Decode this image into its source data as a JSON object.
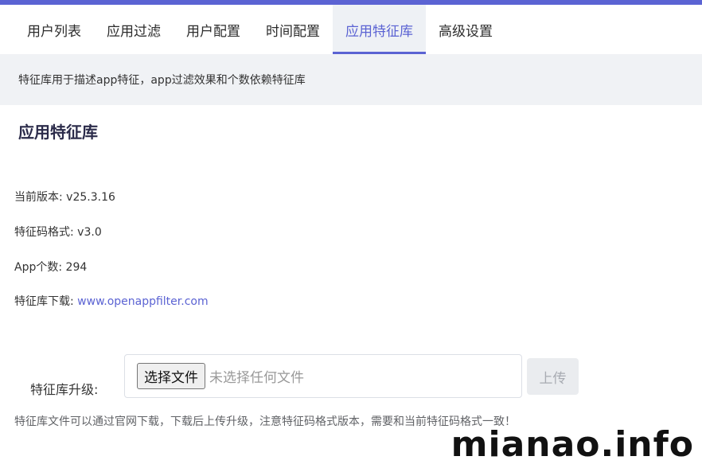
{
  "tabs": [
    {
      "label": "用户列表"
    },
    {
      "label": "应用过滤"
    },
    {
      "label": "用户配置"
    },
    {
      "label": "时间配置"
    },
    {
      "label": "应用特征库"
    },
    {
      "label": "高级设置"
    }
  ],
  "active_tab": "应用特征库",
  "description": "特征库用于描述app特征，app过滤效果和个数依赖特征库",
  "section_title": "应用特征库",
  "info": {
    "version_label": "当前版本: ",
    "version_value": "v25.3.16",
    "format_label": "特征码格式: ",
    "format_value": "v3.0",
    "app_count_label": "App个数: ",
    "app_count_value": "294",
    "download_label": "特征库下载: ",
    "download_link": "www.openappfilter.com"
  },
  "upgrade": {
    "label": "特征库升级:",
    "choose_file_button": "选择文件",
    "file_status": "未选择任何文件",
    "upload_button": "上传"
  },
  "hint": "特征库文件可以通过官网下载，下载后上传升级，注意特征码格式版本，需要和当前特征码格式一致！",
  "watermark": "mianao.info",
  "colors": {
    "accent": "#5b63d3",
    "desc_bg": "#f0f2f5",
    "title": "#2b2b4a"
  }
}
